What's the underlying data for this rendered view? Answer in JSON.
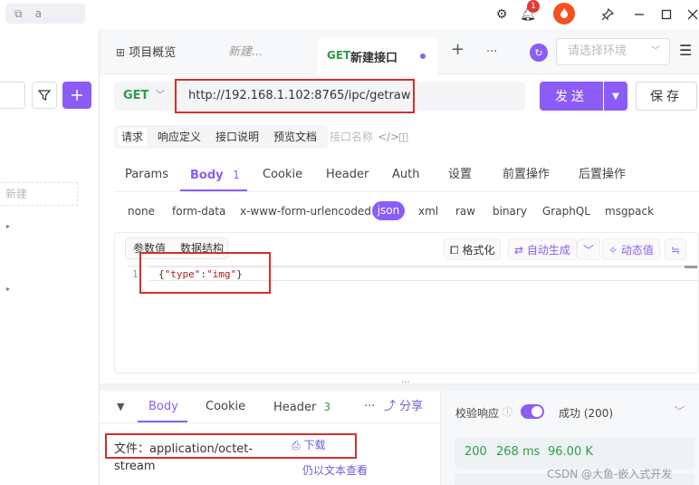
{
  "window": {
    "tab_label": "a"
  },
  "notifications": {
    "count": "1"
  },
  "tabs": {
    "overview": "项目概览",
    "draft": "新建...",
    "active_method": "GET",
    "active_title": "新建接口",
    "add": "+",
    "more": "···"
  },
  "environment": {
    "placeholder": "请选择环境"
  },
  "sidebar": {
    "new_placeholder": "新建"
  },
  "request": {
    "method": "GET",
    "url": "http://192.168.1.102:8765/ipc/getraw",
    "send_label": "发送",
    "save_label": "保存"
  },
  "subtabs": [
    "请求",
    "响应定义",
    "接口说明",
    "预览文档"
  ],
  "subtab_name_placeholder": "接口名称",
  "param_tabs": [
    {
      "label": "Params"
    },
    {
      "label": "Body",
      "badge": "1"
    },
    {
      "label": "Cookie"
    },
    {
      "label": "Header"
    },
    {
      "label": "Auth"
    },
    {
      "label": "设置"
    },
    {
      "label": "前置操作"
    },
    {
      "label": "后置操作"
    }
  ],
  "body_types": [
    "none",
    "form-data",
    "x-www-form-urlencoded",
    "json",
    "xml",
    "raw",
    "binary",
    "GraphQL",
    "msgpack"
  ],
  "editor": {
    "tab_params": "参数值",
    "tab_schema": "数据结构",
    "format_btn": "格式化",
    "autogen_btn": "自动生成",
    "dynamic_btn": "动态值",
    "line_number": "1",
    "code_open": "{",
    "code_key": "\"type\"",
    "code_colon": ":",
    "code_value": "\"img\"",
    "code_close": "}"
  },
  "response": {
    "tabs": [
      {
        "label": "Body"
      },
      {
        "label": "Cookie"
      },
      {
        "label": "Header",
        "badge": "3"
      }
    ],
    "share_label": "分享",
    "file_text": "文件：application/octet-",
    "file_text_cont": "stream",
    "download_label": "下载",
    "view_as_text": "仍以文本查看",
    "validate_label": "校验响应",
    "validate_result": "成功 (200)",
    "status_code": "200",
    "time": "268 ms",
    "size": "96.00 K"
  },
  "watermark": "CSDN @大鱼-嵌入式开发",
  "colors": {
    "accent": "#8b5cf6",
    "get_method": "#2e9d46",
    "success": "#2e9d46",
    "annotation": "#d32f2f"
  }
}
